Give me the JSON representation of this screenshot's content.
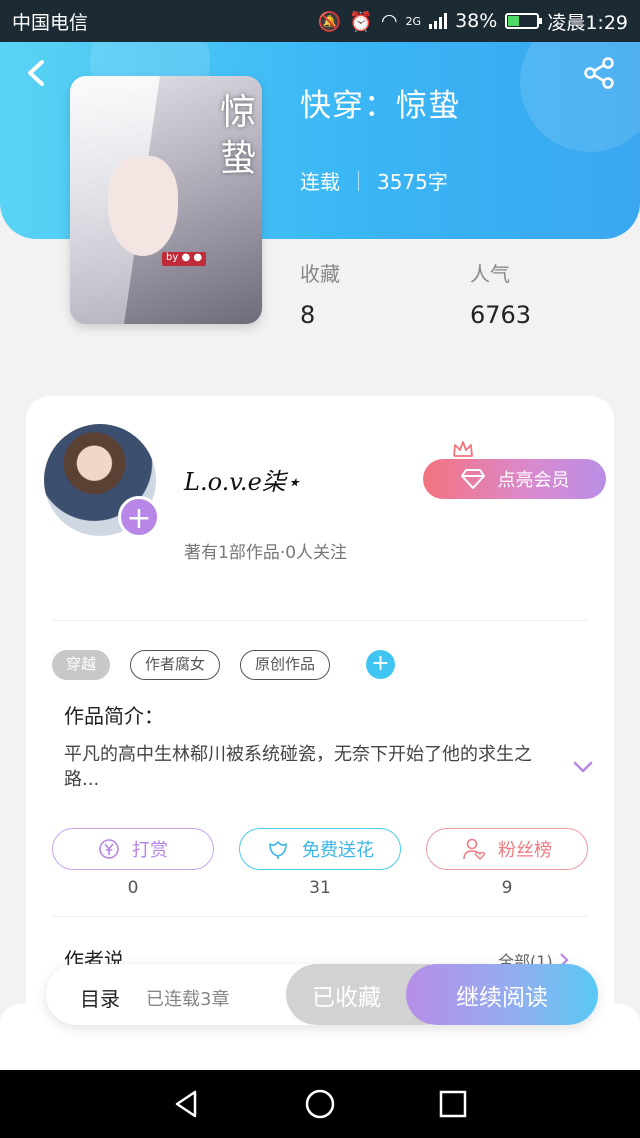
{
  "status_bar": {
    "carrier": "中国电信",
    "network": "2G",
    "battery": "38%",
    "battery_level": 0.38,
    "time": "凌晨1:29"
  },
  "book": {
    "title": "快穿：惊蛰",
    "status": "连载",
    "word_count": "3575字",
    "cover_art_text": "惊蛰"
  },
  "stats": {
    "collect_label": "收藏",
    "collect_value": "8",
    "popularity_label": "人气",
    "popularity_value": "6763"
  },
  "author": {
    "name": "L.o.v.e柒⋆",
    "summary": "著有1部作品·0人关注",
    "vip_label": "点亮会员"
  },
  "tags": [
    "穿越",
    "作者腐女",
    "原创作品"
  ],
  "intro": {
    "title": "作品简介：",
    "text": "平凡的高中生林郗川被系统碰瓷，无奈下开始了他的求生之路..."
  },
  "actions": [
    {
      "label": "打赏",
      "count": "0"
    },
    {
      "label": "免费送花",
      "count": "31"
    },
    {
      "label": "粉丝榜",
      "count": "9"
    }
  ],
  "author_says": {
    "title": "作者说",
    "all_label": "全部(1)"
  },
  "bottom_bar": {
    "catalog": "目录",
    "chapters": "已连载3章",
    "collected": "已收藏",
    "continue_reading": "继续阅读"
  },
  "colors": {
    "accent_blue": "#3ab6f5",
    "purple": "#b886e6",
    "pink": "#f4737f",
    "cyan": "#40c4f2"
  }
}
